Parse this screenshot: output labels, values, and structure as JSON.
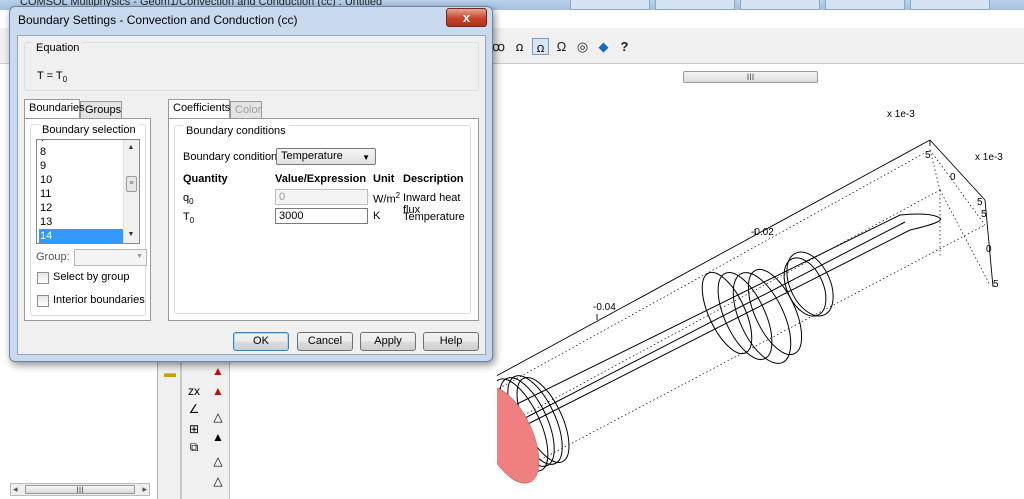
{
  "app": {
    "title": "COMSOL Multiphysics - Geom1/Convection and Conduction (cc) : Untitled",
    "hscroll_grip": "III",
    "left_hscroll_grip": "III",
    "toolbar_icons": [
      "axis-xyz-icon",
      "axis-mirror-icon",
      "axis-active-icon",
      "omega-icon",
      "sphere-icon",
      "color-icon",
      "help-icon"
    ]
  },
  "plot": {
    "tick_labels": {
      "x_scale": "x 1e-3",
      "y_scale": "x 1e-3",
      "z_top": "5",
      "z_mid": "0",
      "y_5a": "5",
      "y_5b": "5",
      "y_0": "0",
      "y_m5": "5",
      "x_002": "-0.02",
      "x_004": "-0.04"
    },
    "colors": {
      "selected_boundary": "#f08080",
      "edges": "#000000"
    }
  },
  "dialog": {
    "title": "Boundary Settings - Convection and Conduction (cc)",
    "close_label": "x",
    "equation": {
      "label": "Equation",
      "lhs": "T = T",
      "sub": "0"
    },
    "left_tabs": [
      "Boundaries",
      "Groups"
    ],
    "boundary_selection": {
      "label": "Boundary selection",
      "items": [
        "8",
        "9",
        "10",
        "11",
        "12",
        "13",
        "14"
      ],
      "selected": "14",
      "group_label": "Group:",
      "group_value": "",
      "select_by_group": "Select by group",
      "interior_boundaries": "Interior boundaries"
    },
    "right_tabs": [
      "Coefficients",
      "Color"
    ],
    "boundary_conditions": {
      "label": "Boundary conditions",
      "condition_label": "Boundary condition:",
      "condition_value": "Temperature",
      "headers": {
        "quantity": "Quantity",
        "value": "Value/Expression",
        "unit": "Unit",
        "description": "Description"
      },
      "rows": [
        {
          "quantity": "q",
          "quantity_sub": "0",
          "value": "0",
          "unit": "W/m",
          "unit_sup": "2",
          "description": "Inward heat flux",
          "enabled": false
        },
        {
          "quantity": "T",
          "quantity_sub": "0",
          "value": "3000",
          "unit": "K",
          "unit_sup": "",
          "description": "Temperature",
          "enabled": true
        }
      ]
    },
    "buttons": {
      "ok": "OK",
      "cancel": "Cancel",
      "apply": "Apply",
      "help": "Help"
    }
  }
}
